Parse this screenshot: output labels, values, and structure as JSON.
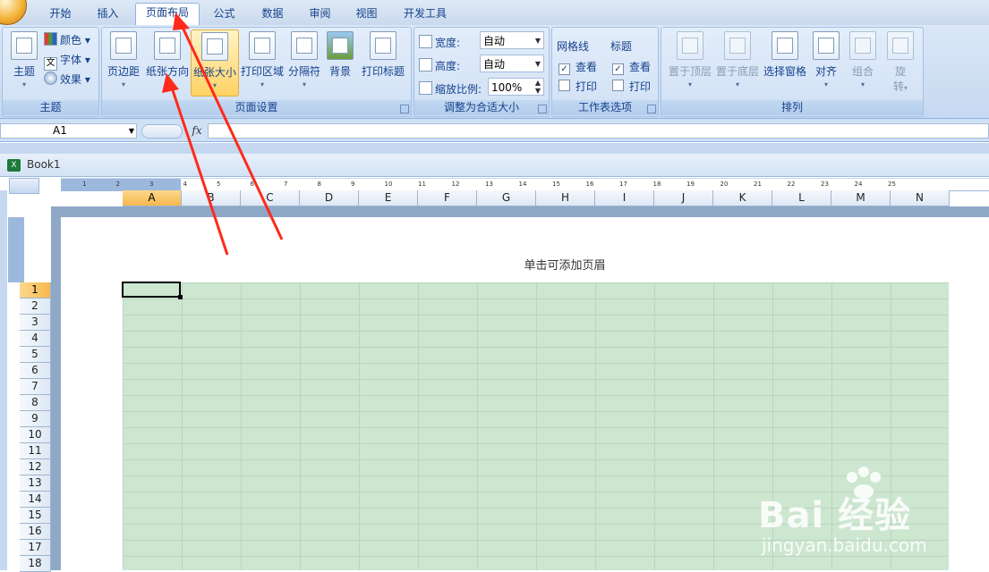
{
  "tabs": [
    {
      "label": "开始"
    },
    {
      "label": "插入"
    },
    {
      "label": "页面布局"
    },
    {
      "label": "公式"
    },
    {
      "label": "数据"
    },
    {
      "label": "审阅"
    },
    {
      "label": "视图"
    },
    {
      "label": "开发工具"
    }
  ],
  "active_tab": "页面布局",
  "ribbon": {
    "theme": {
      "label": "主题",
      "theme_btn": "主题",
      "colors": "颜色",
      "fonts": "字体",
      "effects": "效果"
    },
    "page_setup": {
      "label": "页面设置",
      "margins": "页边距",
      "orientation": "纸张方向",
      "size": "纸张大小",
      "print_area": "打印区域",
      "breaks": "分隔符",
      "background": "背景",
      "print_titles": "打印标题"
    },
    "scale": {
      "label": "调整为合适大小",
      "width_label": "宽度:",
      "width_value": "自动",
      "height_label": "高度:",
      "height_value": "自动",
      "scale_label": "缩放比例:",
      "scale_value": "100%"
    },
    "sheet_options": {
      "label": "工作表选项",
      "gridlines": "网格线",
      "gridlines_view": "查看",
      "gridlines_print": "打印",
      "headings": "标题",
      "headings_view": "查看",
      "headings_print": "打印"
    },
    "arrange": {
      "label": "排列",
      "bring_front": "置于顶层",
      "send_back": "置于底层",
      "selection_pane": "选择窗格",
      "align": "对齐",
      "group": "组合",
      "rotate1": "旋",
      "rotate2": "转"
    }
  },
  "formula_bar": {
    "name_box": "A1",
    "fx": "fx",
    "value": ""
  },
  "workbook": {
    "title": "Book1"
  },
  "columns": [
    "A",
    "B",
    "C",
    "D",
    "E",
    "F",
    "G",
    "H",
    "I",
    "J",
    "K",
    "L",
    "M",
    "N"
  ],
  "rows": [
    "1",
    "2",
    "3",
    "4",
    "5",
    "6",
    "7",
    "8",
    "9",
    "10",
    "11",
    "12",
    "13",
    "14",
    "15",
    "16",
    "17",
    "18"
  ],
  "ruler_numbers": [
    "1",
    "2",
    "3",
    "4",
    "5",
    "6",
    "7",
    "8",
    "9",
    "10",
    "11",
    "12",
    "13",
    "14",
    "15",
    "16",
    "17",
    "18",
    "19",
    "20",
    "21",
    "22",
    "23",
    "24",
    "25"
  ],
  "header_hint": "单击可添加页眉",
  "watermark": {
    "text": "Bai 经验",
    "sub": "jingyan.baidu.com"
  },
  "colors": {
    "selected_header": "#f7b84e",
    "grid_fill": "#cde6d0",
    "arrow": "#ff2a1a"
  }
}
